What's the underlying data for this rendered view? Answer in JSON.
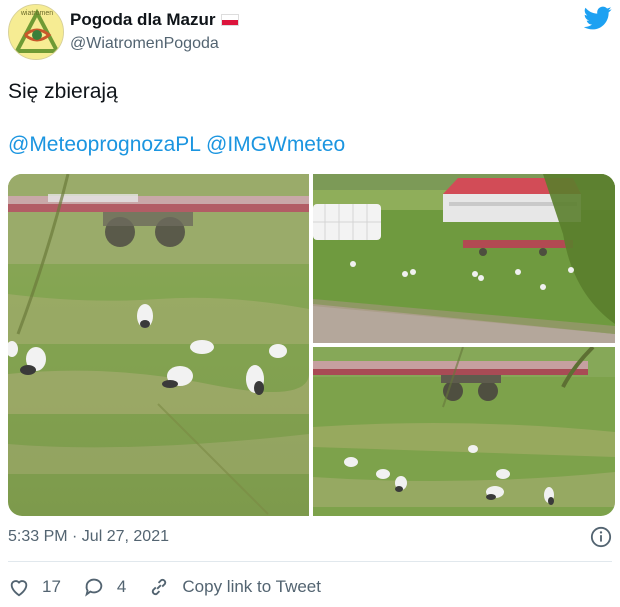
{
  "user": {
    "name": "Pogoda dla Mazur",
    "handle": "@WiatromenPogoda",
    "avatar_text": "wiatromen"
  },
  "tweet": {
    "text": "Się zbierają",
    "mentions": [
      "@MeteoprognozaPL",
      "@IMGWmeteo"
    ],
    "timestamp": "5:33 PM · Jul 27, 2021"
  },
  "actions": {
    "likes": "17",
    "replies": "4",
    "copy_link": "Copy link to Tweet"
  },
  "icons": {
    "brand": "twitter-bird-icon",
    "like": "heart-icon",
    "reply": "reply-icon",
    "link": "link-icon",
    "info": "info-icon"
  },
  "colors": {
    "link": "#1b95e0",
    "twitter_blue": "#1da1f2",
    "muted": "#536471"
  }
}
